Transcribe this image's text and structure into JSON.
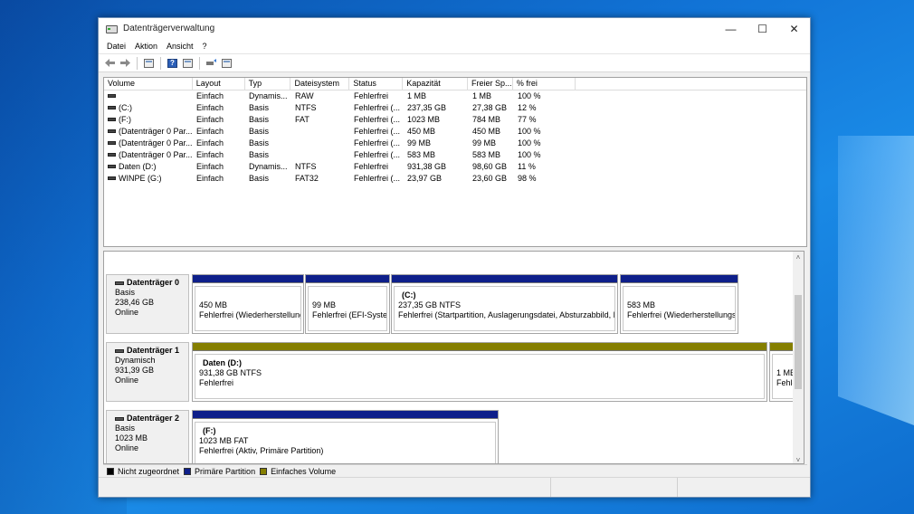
{
  "window": {
    "title": "Datenträgerverwaltung",
    "minimize": "—",
    "maximize": "☐",
    "close": "✕"
  },
  "menu": [
    "Datei",
    "Aktion",
    "Ansicht",
    "?"
  ],
  "toolbar": {
    "back_icon": "back-arrow-icon",
    "forward_icon": "forward-arrow-icon",
    "help_glyph": "?"
  },
  "volume_list": {
    "columns": [
      "Volume",
      "Layout",
      "Typ",
      "Dateisystem",
      "Status",
      "Kapazität",
      "Freier Sp...",
      "% frei",
      ""
    ],
    "rows": [
      [
        "",
        "Einfach",
        "Dynamis...",
        "RAW",
        "Fehlerfrei",
        "1 MB",
        "1 MB",
        "100 %"
      ],
      [
        "(C:)",
        "Einfach",
        "Basis",
        "NTFS",
        "Fehlerfrei (...",
        "237,35 GB",
        "27,38 GB",
        "12 %"
      ],
      [
        "(F:)",
        "Einfach",
        "Basis",
        "FAT",
        "Fehlerfrei (...",
        "1023 MB",
        "784 MB",
        "77 %"
      ],
      [
        "(Datenträger 0 Par...",
        "Einfach",
        "Basis",
        "",
        "Fehlerfrei (...",
        "450 MB",
        "450 MB",
        "100 %"
      ],
      [
        "(Datenträger 0 Par...",
        "Einfach",
        "Basis",
        "",
        "Fehlerfrei (...",
        "99 MB",
        "99 MB",
        "100 %"
      ],
      [
        "(Datenträger 0 Par...",
        "Einfach",
        "Basis",
        "",
        "Fehlerfrei (...",
        "583 MB",
        "583 MB",
        "100 %"
      ],
      [
        "Daten (D:)",
        "Einfach",
        "Dynamis...",
        "NTFS",
        "Fehlerfrei",
        "931,38 GB",
        "98,60 GB",
        "11 %"
      ],
      [
        "WINPE (G:)",
        "Einfach",
        "Basis",
        "FAT32",
        "Fehlerfrei (...",
        "23,97 GB",
        "23,60 GB",
        "98 %"
      ]
    ]
  },
  "disks": [
    {
      "name": "Datenträger 0",
      "type": "Basis",
      "size": "238,46 GB",
      "state": "Online",
      "partitions": [
        {
          "name": "",
          "size": "450 MB",
          "status": "Fehlerfrei (Wiederherstellungspartition)",
          "kind": "primary"
        },
        {
          "name": "",
          "size": "99 MB",
          "status": "Fehlerfrei (EFI-Systempartition)",
          "kind": "primary"
        },
        {
          "name": "(C:)",
          "size": "237,35 GB NTFS",
          "status": "Fehlerfrei (Startpartition, Auslagerungsdatei, Absturzabbild, Basisdatenpartition)",
          "kind": "primary"
        },
        {
          "name": "",
          "size": "583 MB",
          "status": "Fehlerfrei (Wiederherstellungspartition)",
          "kind": "primary"
        }
      ]
    },
    {
      "name": "Datenträger 1",
      "type": "Dynamisch",
      "size": "931,39 GB",
      "state": "Online",
      "partitions": [
        {
          "name": "Daten (D:)",
          "size": "931,38 GB NTFS",
          "status": "Fehlerfrei",
          "kind": "simple"
        },
        {
          "name": "",
          "size": "1 MB",
          "status": "Fehlerfrei",
          "kind": "simple"
        }
      ]
    },
    {
      "name": "Datenträger 2",
      "type": "Basis",
      "size": "1023 MB",
      "state": "Online",
      "partitions": [
        {
          "name": "(F:)",
          "size": "1023 MB FAT",
          "status": "Fehlerfrei (Aktiv, Primäre Partition)",
          "kind": "primary"
        }
      ]
    }
  ],
  "legend": [
    {
      "label": "Nicht zugeordnet",
      "color": "#000000"
    },
    {
      "label": "Primäre Partition",
      "color": "#0e1f8a"
    },
    {
      "label": "Einfaches Volume",
      "color": "#857f00"
    }
  ],
  "scroll": {
    "up": "˄",
    "down": "˅"
  }
}
